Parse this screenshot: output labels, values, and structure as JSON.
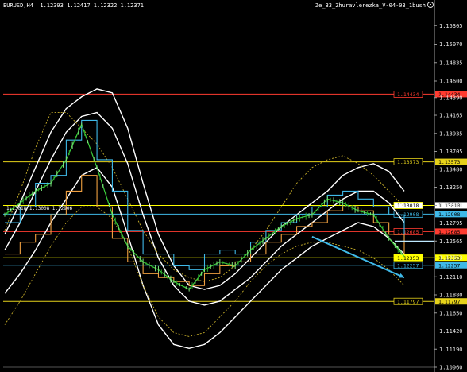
{
  "header": {
    "symbol_info": "EURUSD,H4  1.12393 1.12417 1.12322 1.12371",
    "indicator_name": "Ze_33_Zhuravlerezka_V-04-03_1bush"
  },
  "overlay_label": "1.13018 1.13008 1.12906",
  "chart_data": {
    "type": "line",
    "symbol": "EURUSD",
    "timeframe": "H4",
    "ohlc": {
      "open": 1.12393,
      "high": 1.12417,
      "low": 1.12322,
      "close": 1.12371
    },
    "y_axis_ticks": [
      "1.15305",
      "1.15070",
      "1.14835",
      "1.14600",
      "1.14390",
      "1.14165",
      "1.13935",
      "1.13705",
      "1.13480",
      "1.13250",
      "1.13018",
      "1.12795",
      "1.12565",
      "1.12353",
      "1.12110",
      "1.11880",
      "1.11650",
      "1.11420",
      "1.11190",
      "1.10960"
    ],
    "ylim": [
      1.1096,
      1.1551
    ],
    "levels": [
      {
        "label": "1.14434",
        "value": 1.14434,
        "color": "#ff3b30",
        "box_text_color": "#ff3b30",
        "box_bg": "#000000"
      },
      {
        "label": "1.13573",
        "value": 1.13573,
        "color": "#e6d21a",
        "box_text_color": "#e6d21a",
        "box_bg": "#000000"
      },
      {
        "label": "1.13018",
        "value": 1.13018,
        "color": "#ffff00",
        "box_text_color": "#000000",
        "box_bg": "#ffffff"
      },
      {
        "label": "1.12908",
        "value": 1.12908,
        "color": "#3fb9e8",
        "box_text_color": "#3fb9e8",
        "box_bg": "#000000"
      },
      {
        "label": "1.12685",
        "value": 1.12685,
        "color": "#ff3b30",
        "box_text_color": "#ff3b30",
        "box_bg": "#000000"
      },
      {
        "label": "1.12353",
        "value": 1.12353,
        "color": "#ffff00",
        "box_text_color": "#000000",
        "box_bg": "#ffff00"
      },
      {
        "label": "1.12257",
        "value": 1.12257,
        "color": "#3fb9e8",
        "box_text_color": "#3fb9e8",
        "box_bg": "#000000"
      },
      {
        "label": "1.11797",
        "value": 1.11797,
        "color": "#e6d21a",
        "box_text_color": "#e6d21a",
        "box_bg": "#000000"
      }
    ],
    "series": [
      {
        "style": "white",
        "values": [
          1.1265,
          1.1305,
          1.135,
          1.1395,
          1.1425,
          1.144,
          1.145,
          1.1445,
          1.14,
          1.133,
          1.1265,
          1.1225,
          1.12,
          1.1195,
          1.12,
          1.1215,
          1.1235,
          1.1255,
          1.1275,
          1.129,
          1.1305,
          1.132,
          1.134,
          1.135,
          1.1355,
          1.1345,
          1.132
        ]
      },
      {
        "style": "white",
        "values": [
          1.1245,
          1.128,
          1.132,
          1.136,
          1.1395,
          1.1415,
          1.142,
          1.14,
          1.1355,
          1.129,
          1.1235,
          1.12,
          1.118,
          1.1175,
          1.118,
          1.1195,
          1.121,
          1.123,
          1.125,
          1.1265,
          1.128,
          1.1295,
          1.131,
          1.132,
          1.132,
          1.1305,
          1.128
        ]
      },
      {
        "style": "white",
        "values": [
          1.119,
          1.1215,
          1.1245,
          1.128,
          1.131,
          1.134,
          1.135,
          1.1325,
          1.1265,
          1.12,
          1.115,
          1.1125,
          1.112,
          1.1125,
          1.114,
          1.116,
          1.118,
          1.12,
          1.122,
          1.1235,
          1.125,
          1.126,
          1.127,
          1.128,
          1.1275,
          1.126,
          1.124
        ]
      },
      {
        "style": "gold-dash",
        "values": [
          1.127,
          1.132,
          1.1375,
          1.142,
          1.142,
          1.14,
          1.138,
          1.135,
          1.131,
          1.127,
          1.124,
          1.122,
          1.121,
          1.1205,
          1.121,
          1.1225,
          1.1245,
          1.127,
          1.13,
          1.133,
          1.135,
          1.136,
          1.1365,
          1.1355,
          1.134,
          1.132,
          1.13
        ]
      },
      {
        "style": "gold-dash",
        "values": [
          1.115,
          1.118,
          1.1215,
          1.125,
          1.128,
          1.13,
          1.13,
          1.1285,
          1.125,
          1.12,
          1.116,
          1.114,
          1.1135,
          1.114,
          1.116,
          1.118,
          1.1205,
          1.1225,
          1.124,
          1.125,
          1.1255,
          1.1255,
          1.125,
          1.1245,
          1.1235,
          1.122,
          1.12
        ]
      },
      {
        "style": "blue-step",
        "values": [
          1.128,
          1.13,
          1.133,
          1.134,
          1.1385,
          1.141,
          1.136,
          1.132,
          1.127,
          1.124,
          1.124,
          1.1225,
          1.122,
          1.124,
          1.1245,
          1.124,
          1.1255,
          1.127,
          1.128,
          1.129,
          1.13,
          1.1315,
          1.132,
          1.131,
          1.13,
          1.129,
          1.1255
        ]
      },
      {
        "style": "orange-step",
        "values": [
          1.124,
          1.1255,
          1.1265,
          1.129,
          1.132,
          1.134,
          1.13,
          1.126,
          1.123,
          1.1215,
          1.121,
          1.1205,
          1.12,
          1.1215,
          1.1225,
          1.123,
          1.124,
          1.1255,
          1.1265,
          1.1275,
          1.128,
          1.1295,
          1.13,
          1.1295,
          1.128,
          1.1265,
          1.124
        ]
      },
      {
        "style": "price",
        "values": [
          1.129,
          1.1305,
          1.132,
          1.133,
          1.136,
          1.1405,
          1.135,
          1.129,
          1.125,
          1.123,
          1.122,
          1.1205,
          1.1195,
          1.122,
          1.123,
          1.1225,
          1.1245,
          1.126,
          1.1275,
          1.1285,
          1.129,
          1.131,
          1.1305,
          1.1295,
          1.129,
          1.126,
          1.1237
        ]
      }
    ],
    "arrows": [
      {
        "from": [
          20,
          1.1262
        ],
        "to": [
          26,
          1.121
        ],
        "color": "#3fb9e8"
      }
    ]
  }
}
